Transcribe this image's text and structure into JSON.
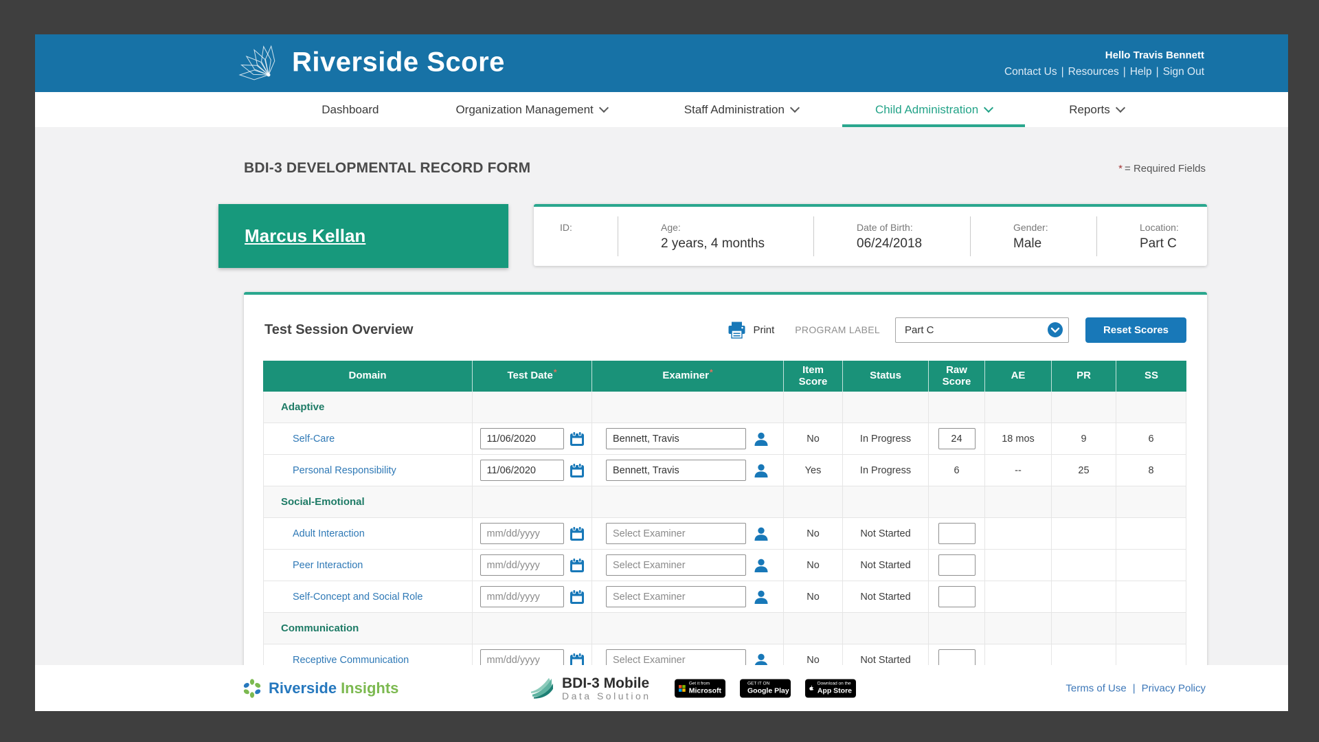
{
  "colors": {
    "header_blue": "#1772A6",
    "teal_accent": "#2AA78E",
    "name_card_green": "#17997C",
    "table_header_green": "#1A9279",
    "category_teal": "#1E7B66",
    "link_blue": "#2F79B6",
    "button_blue": "#1878B8",
    "required_red": "#A23737"
  },
  "icons": {
    "brand_logo": "fan-logo-icon",
    "nav_caret": "chevron-down-icon",
    "print": "printer-icon",
    "select_chevron": "chevron-down-circle-icon",
    "calendar": "calendar-icon",
    "examiner": "person-icon"
  },
  "header": {
    "brand": "Riverside Score",
    "greeting": "Hello Travis Bennett",
    "separator": "|",
    "links": [
      "Contact Us",
      "Resources",
      "Help",
      "Sign Out"
    ]
  },
  "nav": {
    "items": [
      {
        "label": "Dashboard",
        "dropdown": false,
        "active": false
      },
      {
        "label": "Organization Management",
        "dropdown": true,
        "active": false
      },
      {
        "label": "Staff Administration",
        "dropdown": true,
        "active": false
      },
      {
        "label": "Child Administration",
        "dropdown": true,
        "active": true
      },
      {
        "label": "Reports",
        "dropdown": true,
        "active": false
      }
    ]
  },
  "page": {
    "title": "BDI-3 DEVELOPMENTAL RECORD FORM",
    "required_star": "*",
    "required_note": "= Required Fields"
  },
  "student": {
    "name": "Marcus Kellan",
    "fields": [
      {
        "label": "ID:",
        "value": ""
      },
      {
        "label": "Age:",
        "value": "2 years, 4 months"
      },
      {
        "label": "Date of Birth:",
        "value": "06/24/2018"
      },
      {
        "label": "Gender:",
        "value": "Male"
      },
      {
        "label": "Location:",
        "value": "Part C"
      }
    ]
  },
  "session": {
    "title": "Test Session Overview",
    "print_label": "Print",
    "program_label": "PROGRAM LABEL",
    "program_value": "Part C",
    "reset_label": "Reset Scores"
  },
  "table": {
    "required_marker": "*",
    "date_placeholder": "mm/dd/yyyy",
    "examiner_placeholder": "Select Examiner",
    "columns": [
      {
        "label": "Domain",
        "required": false
      },
      {
        "label": "Test Date",
        "required": true
      },
      {
        "label": "Examiner",
        "required": true
      },
      {
        "label": "Item Score",
        "required": false
      },
      {
        "label": "Status",
        "required": false
      },
      {
        "label": "Raw Score",
        "required": false
      },
      {
        "label": "AE",
        "required": false
      },
      {
        "label": "PR",
        "required": false
      },
      {
        "label": "SS",
        "required": false
      }
    ],
    "rows": [
      {
        "type": "category",
        "label": "Adaptive"
      },
      {
        "type": "domain",
        "domain": "Self-Care",
        "test_date": "11/06/2020",
        "examiner": "Bennett, Travis",
        "item_score": "No",
        "status": "In Progress",
        "raw_score": "24",
        "raw_input": true,
        "ae": "18 mos",
        "pr": "9",
        "ss": "6"
      },
      {
        "type": "domain",
        "domain": "Personal Responsibility",
        "test_date": "11/06/2020",
        "examiner": "Bennett, Travis",
        "item_score": "Yes",
        "status": "In Progress",
        "raw_score": "6",
        "raw_input": false,
        "ae": "--",
        "pr": "25",
        "ss": "8"
      },
      {
        "type": "category",
        "label": "Social-Emotional"
      },
      {
        "type": "domain",
        "domain": "Adult Interaction",
        "test_date": "",
        "examiner": "",
        "item_score": "No",
        "status": "Not Started",
        "raw_score": "",
        "raw_input": true,
        "ae": "",
        "pr": "",
        "ss": ""
      },
      {
        "type": "domain",
        "domain": "Peer Interaction",
        "test_date": "",
        "examiner": "",
        "item_score": "No",
        "status": "Not Started",
        "raw_score": "",
        "raw_input": true,
        "ae": "",
        "pr": "",
        "ss": ""
      },
      {
        "type": "domain",
        "domain": "Self-Concept and Social Role",
        "test_date": "",
        "examiner": "",
        "item_score": "No",
        "status": "Not Started",
        "raw_score": "",
        "raw_input": true,
        "ae": "",
        "pr": "",
        "ss": ""
      },
      {
        "type": "category",
        "label": "Communication"
      },
      {
        "type": "domain",
        "domain": "Receptive Communication",
        "test_date": "",
        "examiner": "",
        "item_score": "No",
        "status": "Not Started",
        "raw_score": "",
        "raw_input": true,
        "ae": "",
        "pr": "",
        "ss": ""
      }
    ]
  },
  "footer": {
    "riverside": "Riverside",
    "insights": "Insights",
    "product_name": "BDI-3 Mobile",
    "product_sub": "Data Solution",
    "separator": "|",
    "badges": [
      {
        "top": "Get it from",
        "bottom": "Microsoft"
      },
      {
        "top": "GET IT ON",
        "bottom": "Google Play"
      },
      {
        "top": "Download on the",
        "bottom": "App Store"
      }
    ],
    "links": [
      "Terms of Use",
      "Privacy Policy"
    ]
  }
}
